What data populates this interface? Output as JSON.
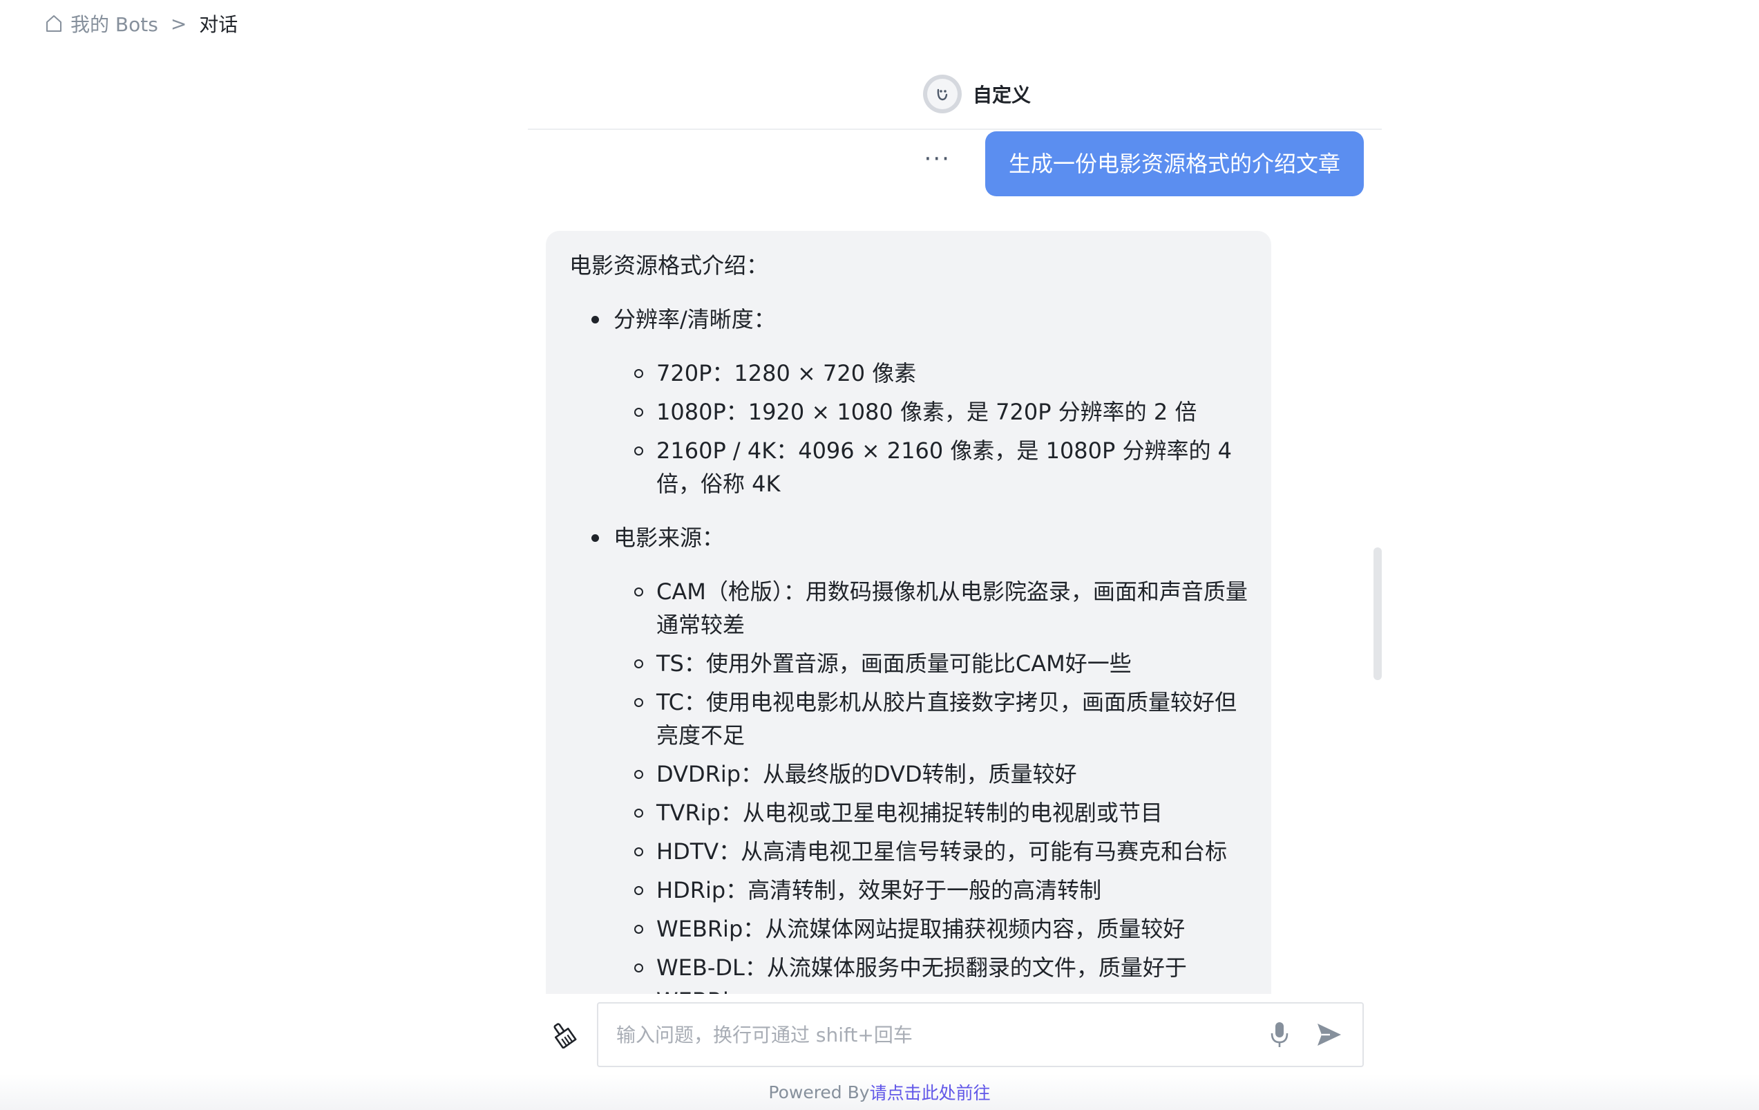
{
  "breadcrumb": {
    "root_label": "我的 Bots",
    "separator": ">",
    "current_label": "对话"
  },
  "bot": {
    "name": "自定义"
  },
  "messages": {
    "user_text": "生成一份电影资源格式的介绍文章",
    "more_label": "···",
    "bot": {
      "intro": "电影资源格式介绍：",
      "sections": [
        {
          "title": "分辨率/清晰度：",
          "items": [
            "720P：1280 × 720 像素",
            "1080P：1920 × 1080 像素，是 720P 分辨率的 2 倍",
            "2160P / 4K：4096 × 2160 像素，是 1080P 分辨率的 4 倍，俗称 4K"
          ]
        },
        {
          "title": "电影来源：",
          "items": [
            "CAM（枪版）：用数码摄像机从电影院盗录，画面和声音质量通常较差",
            "TS：使用外置音源，画面质量可能比CAM好一些",
            "TC：使用电视电影机从胶片直接数字拷贝，画面质量较好但亮度不足",
            "DVDRip：从最终版的DVD转制，质量较好",
            "TVRip：从电视或卫星电视捕捉转制的电视剧或节目",
            "HDTV：从高清电视卫星信号转录的，可能有马赛克和台标",
            "HDRip：高清转制，效果好于一般的高清转制",
            "WEBRip：从流媒体网站提取捕获视频内容，质量较好",
            "WEB-DL：从流媒体服务中无损翻录的文件，质量好于WEBRip"
          ]
        }
      ]
    }
  },
  "input": {
    "placeholder": "输入问题，换行可通过 shift+回车"
  },
  "footer": {
    "powered_text": "Powered By",
    "link_text": "请点击此处前往"
  },
  "colors": {
    "user_bubble": "#5b8ef0",
    "bot_bubble": "#f2f3f5",
    "footer_link": "#6157e8"
  },
  "icons": {
    "home": "home-icon",
    "avatar": "bot-avatar-icon",
    "clear": "broom-icon",
    "mic": "microphone-icon",
    "send": "send-icon"
  }
}
